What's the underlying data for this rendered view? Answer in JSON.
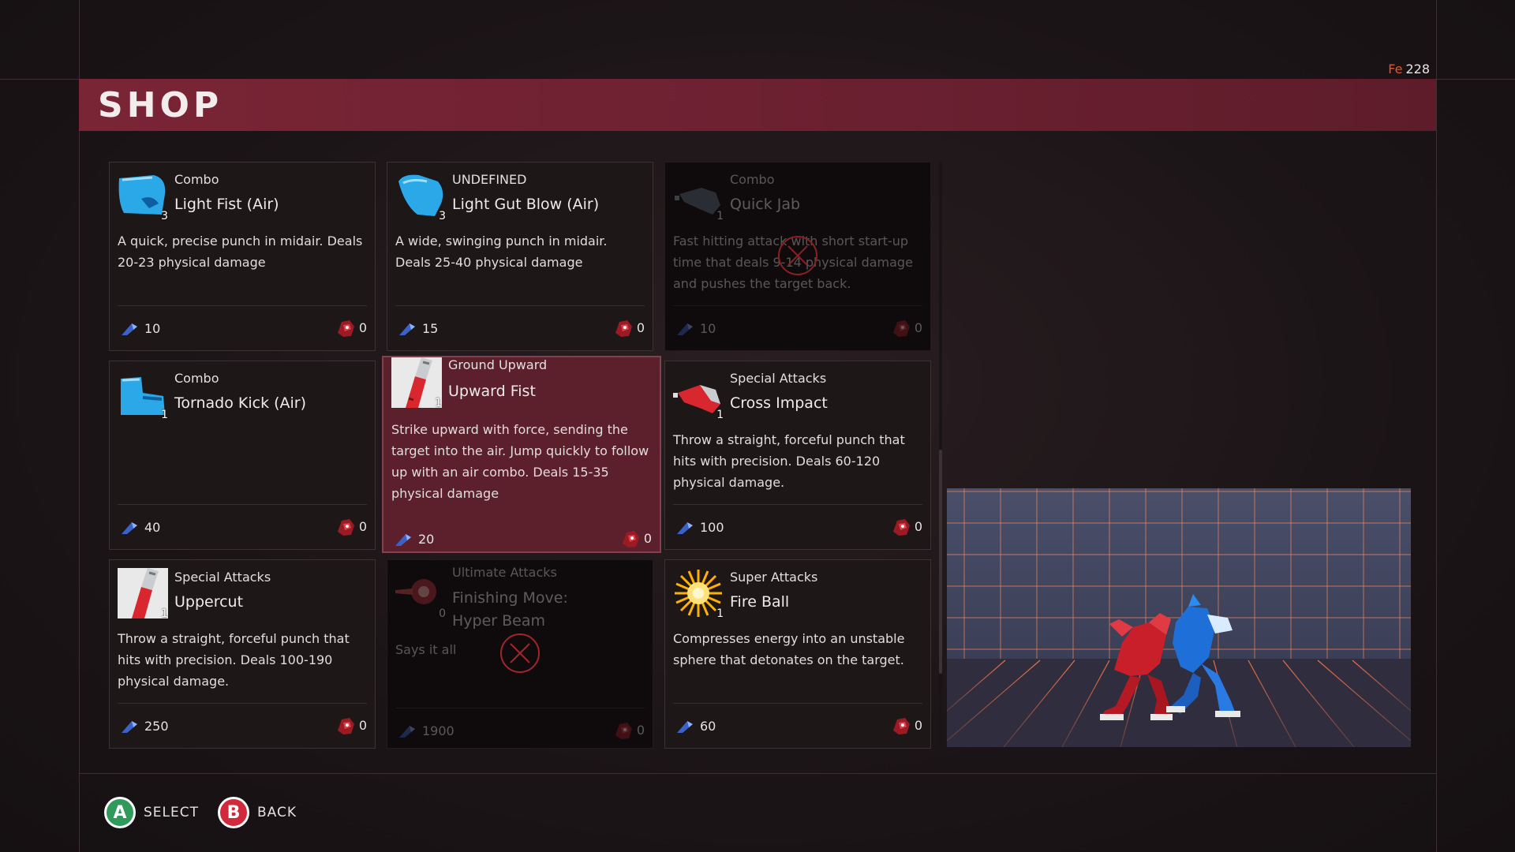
{
  "currency": {
    "symbol": "Fe",
    "amount": "228"
  },
  "title": "SHOP",
  "items": [
    {
      "category": "Combo",
      "name": "Light Fist (Air)",
      "desc": "A quick, precise punch in midair. Deals 20-23 physical damage",
      "cost": "10",
      "enemy": "0",
      "icon_num": "3",
      "icon": "blue-fist-icon",
      "state": "normal"
    },
    {
      "category": "UNDEFINED",
      "name": "Light Gut Blow (Air)",
      "desc": "A wide, swinging punch in midair. Deals 25-40 physical damage",
      "cost": "15",
      "enemy": "0",
      "icon_num": "3",
      "icon": "blue-fist-icon",
      "state": "normal"
    },
    {
      "category": "Combo",
      "name": "Quick Jab",
      "desc": "Fast hitting attack with short start-up time that deals 9-14 physical damage and pushes the target back.",
      "cost": "10",
      "enemy": "0",
      "icon_num": "1",
      "icon": "gray-fist-icon",
      "state": "locked"
    },
    {
      "category": "Combo",
      "name": "Tornado Kick (Air)",
      "desc": "",
      "cost": "40",
      "enemy": "0",
      "icon_num": "1",
      "icon": "blue-boot-icon",
      "state": "normal"
    },
    {
      "category": "Ground Upward",
      "name": "Upward Fist",
      "desc": "Strike upward with force, sending the target into the air. Jump quickly to follow up with an air combo. Deals 15-35 physical damage",
      "cost": "20",
      "enemy": "0",
      "icon_num": "1",
      "icon": "red-arm-icon",
      "state": "selected"
    },
    {
      "category": "Special Attacks",
      "name": "Cross Impact",
      "desc": "Throw a straight, forceful punch that hits with precision. Deals 60-120 physical damage.",
      "cost": "100",
      "enemy": "0",
      "icon_num": "1",
      "icon": "red-fist-icon",
      "state": "normal"
    },
    {
      "category": "Special Attacks",
      "name": "Uppercut",
      "desc": "Throw a straight, forceful punch that hits with precision. Deals 100-190 physical damage.",
      "cost": "250",
      "enemy": "0",
      "icon_num": "1",
      "icon": "red-arm-icon",
      "state": "normal"
    },
    {
      "category": "Ultimate Attacks",
      "name": "Finishing Move: Hyper Beam",
      "desc": "Says it all",
      "cost": "1900",
      "enemy": "0",
      "icon_num": "0",
      "icon": "red-beam-icon",
      "state": "locked"
    },
    {
      "category": "Super Attacks",
      "name": "Fire Ball",
      "desc": "Compresses energy into an unstable sphere that detonates on the target.",
      "cost": "60",
      "enemy": "0",
      "icon_num": "1",
      "icon": "fireball-icon",
      "state": "normal"
    }
  ],
  "footer": {
    "select_glyph": "A",
    "select_label": "SELECT",
    "back_glyph": "B",
    "back_label": "BACK"
  },
  "colors": {
    "banner": "#7a2536",
    "selected_card": "#5c1f2c",
    "grid_glow": "#ff6a3a"
  }
}
